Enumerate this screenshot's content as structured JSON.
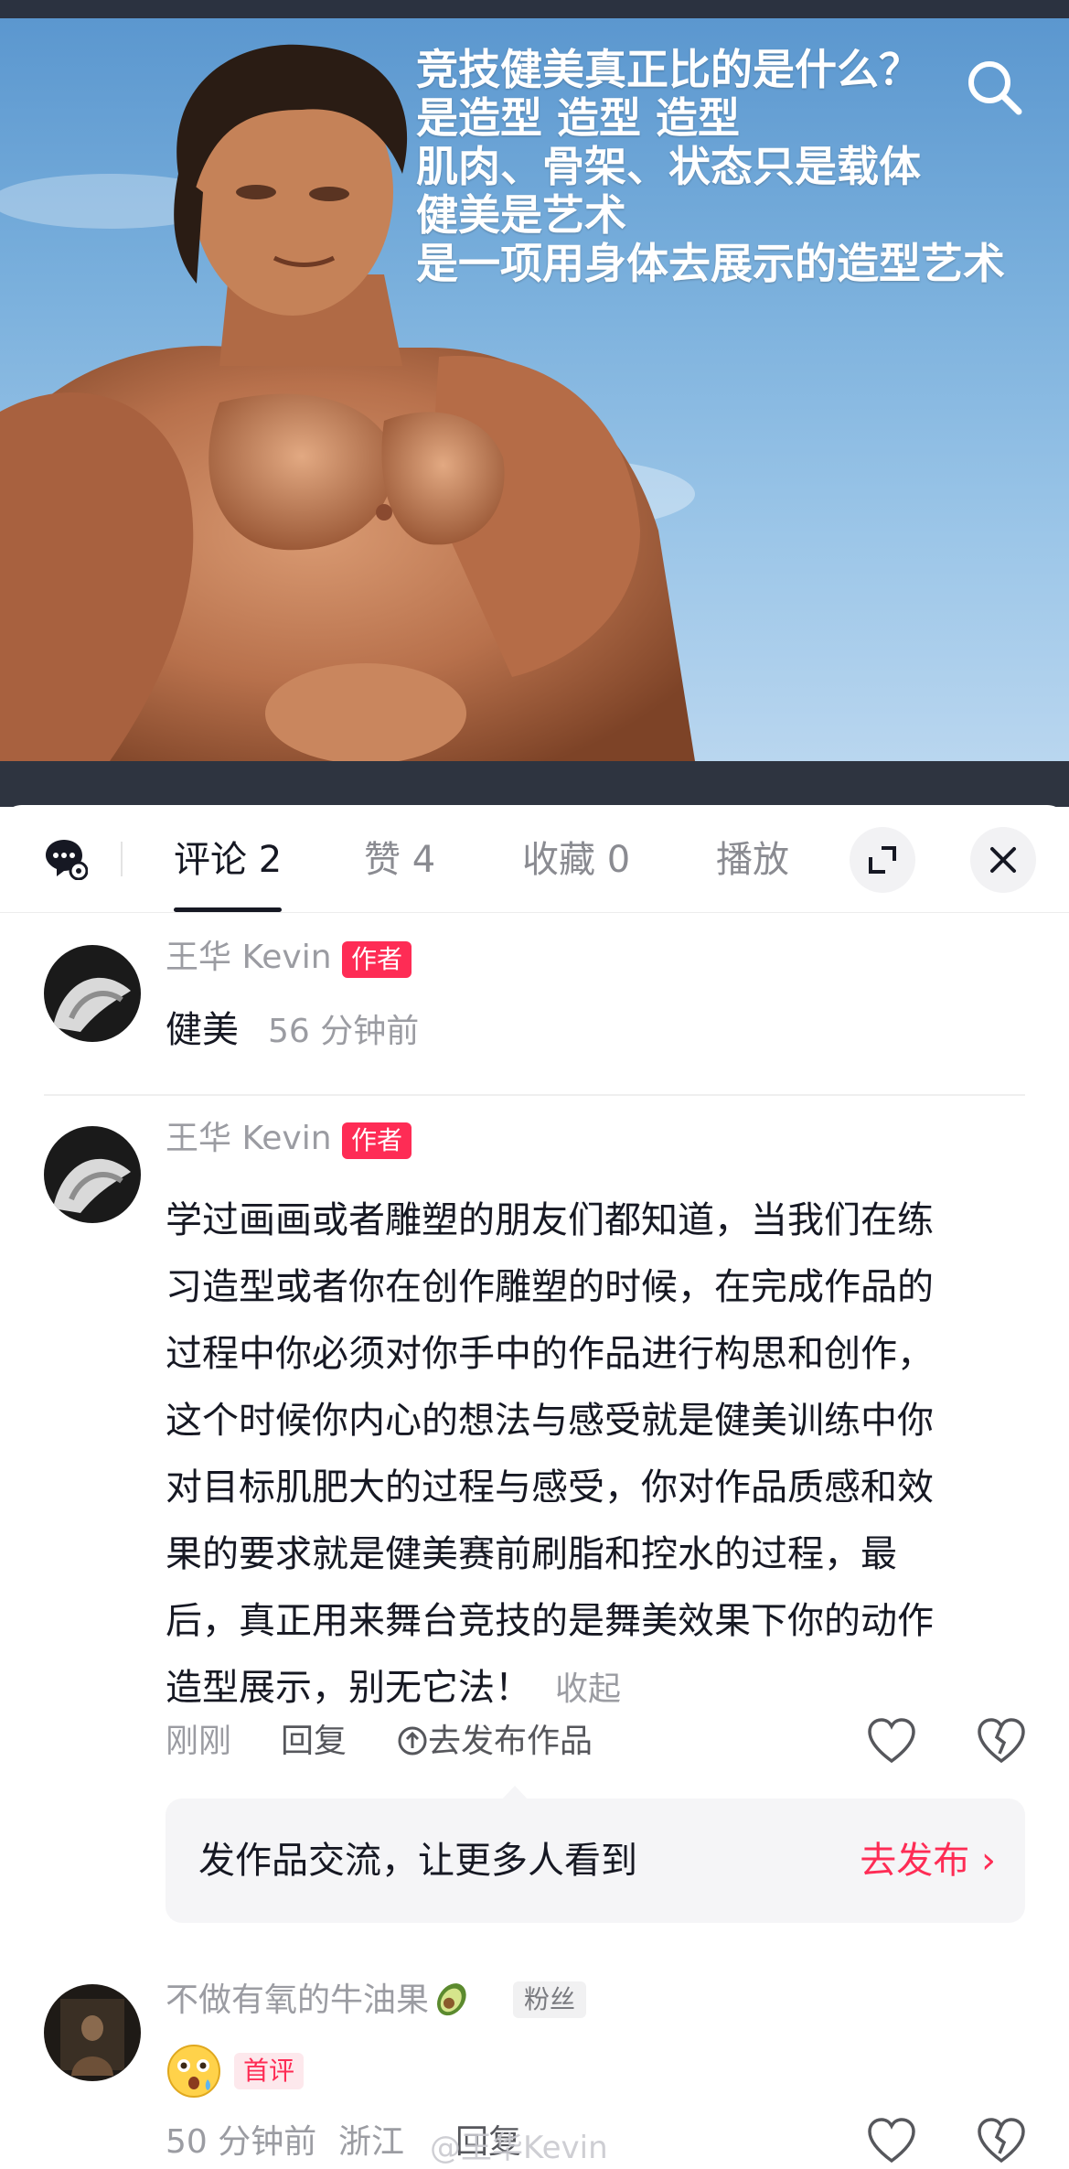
{
  "video": {
    "overlay_lines": [
      "竞技健美真正比的是什么？",
      "是造型 造型 造型",
      "肌肉、骨架、状态只是载体",
      "健美是艺术",
      "是一项用身体去展示的造型艺术"
    ]
  },
  "tabs": {
    "comments": "评论 2",
    "likes": "赞 4",
    "favorites": "收藏 0",
    "plays": "播放"
  },
  "comments": [
    {
      "name": "王华 Kevin",
      "badge": "作者",
      "text": "健美",
      "time": "56 分钟前"
    },
    {
      "name": "王华 Kevin",
      "badge": "作者",
      "lines": [
        "学过画画或者雕塑的朋友们都知道，当我们在练",
        "习造型或者你在创作雕塑的时候，在完成作品的",
        "过程中你必须对你手中的作品进行构思和创作，",
        "这个时候你内心的想法与感受就是健美训练中你",
        "对目标肌肥大的过程与感受，你对作品质感和效",
        "果的要求就是健美赛前刷脂和控水的过程，最",
        "后，真正用来舞台竞技的是舞美效果下你的动作",
        "造型展示，别无它法！"
      ],
      "collapse": "收起",
      "time": "刚刚",
      "reply": "回复",
      "publish": "去发布作品"
    },
    {
      "name": "不做有氧的牛油果",
      "badge": "粉丝",
      "first_badge": "首评",
      "time": "50 分钟前",
      "location": "浙江",
      "reply": "回复"
    }
  ],
  "promo": {
    "text": "发作品交流，让更多人看到",
    "link": "去发布 ›"
  },
  "watermark": "@王华Kevin",
  "colors": {
    "accent": "#fe2c55",
    "muted_text": "#9b9ca2",
    "primary_text": "#161823"
  }
}
